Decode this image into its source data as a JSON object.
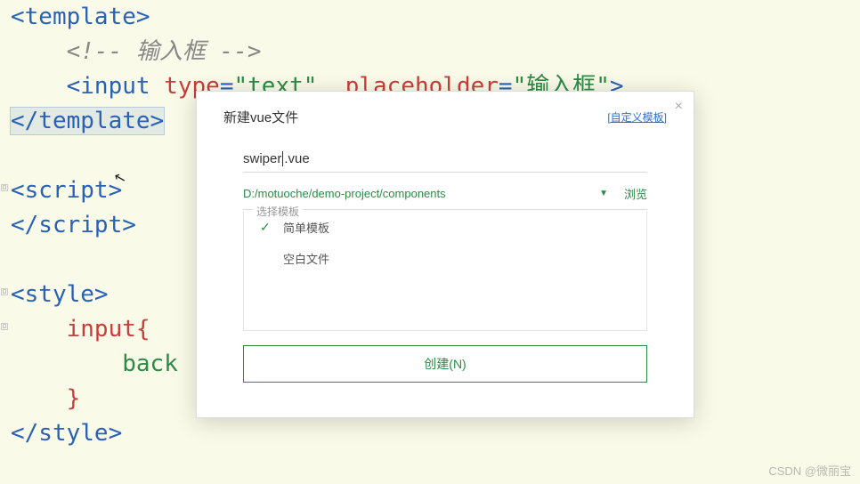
{
  "code": {
    "line1_a": "<template>",
    "line2_indent": "    ",
    "line2_comment": "<!-- 输入框 -->",
    "line3_indent": "    ",
    "line3_a": "<input",
    "line3_b": " ",
    "line3_c": "type",
    "line3_d": "=",
    "line3_e": "\"text\"",
    "line3_f": "  ",
    "line3_g": "placeholder",
    "line3_h": "=",
    "line3_i": "\"输入框\"",
    "line3_j": ">",
    "line4": "</template>",
    "line6": "<script>",
    "line7": "</script>",
    "line9": "<style>",
    "line10_indent": "    ",
    "line10": "input{",
    "line11_indent": "        ",
    "line11": "back",
    "line12_indent": "    ",
    "line12": "}",
    "line13": "</style>"
  },
  "dialog": {
    "title": "新建vue文件",
    "custom_link": "[自定义模板]",
    "filename_a": "swiper",
    "filename_b": ".vue",
    "path": "D:/motuoche/demo-project/components",
    "browse": "浏览",
    "template_legend": "选择模板",
    "template_items": [
      {
        "label": "简单模板",
        "selected": true
      },
      {
        "label": "空白文件",
        "selected": false
      }
    ],
    "create_btn": "创建(N)"
  },
  "watermark": "CSDN @微丽宝"
}
